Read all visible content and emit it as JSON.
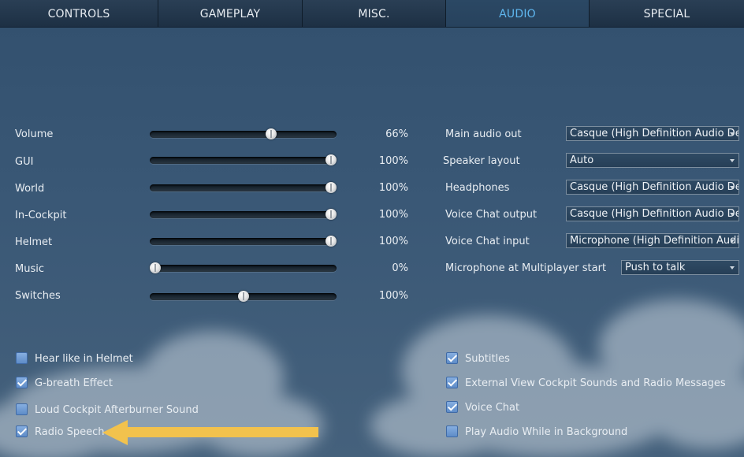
{
  "tabs": [
    {
      "label": "CONTROLS"
    },
    {
      "label": "GAMEPLAY"
    },
    {
      "label": "MISC."
    },
    {
      "label": "AUDIO",
      "active": true
    },
    {
      "label": "SPECIAL"
    }
  ],
  "sliders": [
    {
      "label": "Volume",
      "value": 66,
      "display": "66%"
    },
    {
      "label": "GUI",
      "value": 100,
      "display": "100%"
    },
    {
      "label": "World",
      "value": 100,
      "display": "100%"
    },
    {
      "label": "In-Cockpit",
      "value": 100,
      "display": "100%"
    },
    {
      "label": "Helmet",
      "value": 100,
      "display": "100%"
    },
    {
      "label": "Music",
      "value": 0,
      "display": "0%"
    },
    {
      "label": "Switches",
      "value": 50,
      "display": "100%"
    }
  ],
  "dropdowns": [
    {
      "label": "Main audio out",
      "value": "Casque (High Definition Audio Dev"
    },
    {
      "label": "Speaker layout",
      "value": "Auto"
    },
    {
      "label": "Headphones",
      "value": "Casque (High Definition Audio Dev"
    },
    {
      "label": "Voice Chat output",
      "value": "Casque (High Definition Audio Dev"
    },
    {
      "label": "Voice Chat input",
      "value": "Microphone (High Definition Audio"
    },
    {
      "label": "Microphone at Multiplayer start",
      "value": "Push to talk"
    }
  ],
  "checkboxes_left": [
    {
      "label": "Hear like in Helmet",
      "checked": false
    },
    {
      "label": "G-breath Effect",
      "checked": true
    },
    {
      "label": "Loud Cockpit Afterburner Sound",
      "checked": false
    },
    {
      "label": "Radio Speech",
      "checked": true
    }
  ],
  "checkboxes_right": [
    {
      "label": "Subtitles",
      "checked": true
    },
    {
      "label": "External View Cockpit Sounds and Radio Messages",
      "checked": true
    },
    {
      "label": "Voice Chat",
      "checked": true
    },
    {
      "label": "Play Audio While in Background",
      "checked": false
    }
  ],
  "annotation": {
    "color": "#f2c24d",
    "icon": "arrow-left-icon"
  }
}
